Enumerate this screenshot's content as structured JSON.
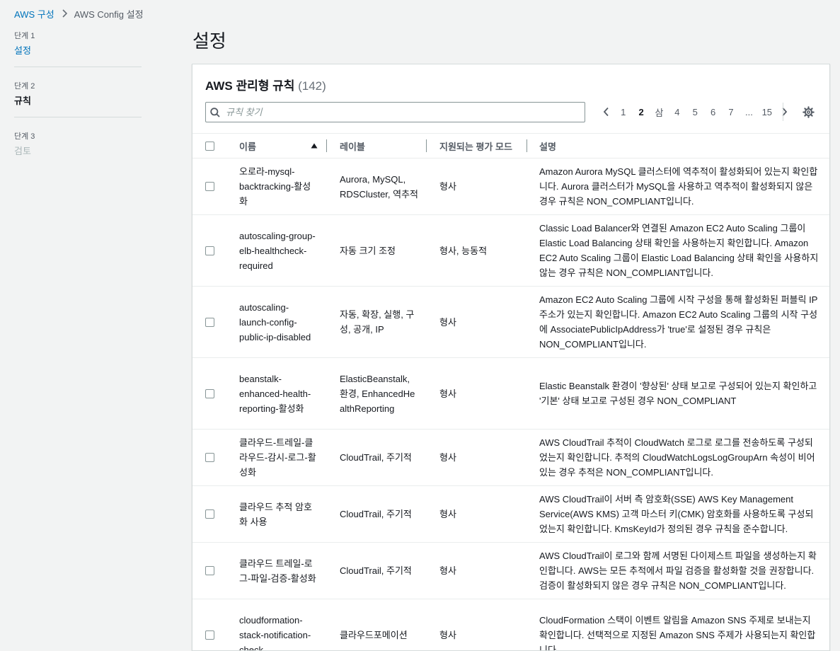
{
  "breadcrumb": {
    "root": "AWS 구성",
    "current": "AWS Config 설정"
  },
  "steps": [
    {
      "num": "단계 1",
      "title": "설정",
      "state": "link"
    },
    {
      "num": "단계 2",
      "title": "규칙",
      "state": "active"
    },
    {
      "num": "단계 3",
      "title": "검토",
      "state": "disabled"
    }
  ],
  "page_title": "설정",
  "panel": {
    "title": "AWS 관리형 규칙",
    "count": "(142)",
    "search_placeholder": "규칙 찾기",
    "pages": [
      "1",
      "2",
      "삼",
      "4",
      "5",
      "6",
      "7",
      "...",
      "15"
    ],
    "current_page": "2"
  },
  "columns": {
    "name": "이름",
    "label": "레이블",
    "mode": "지원되는 평가 모드",
    "desc": "설명"
  },
  "rows": [
    {
      "name": "오로라-mysql-backtracking-활성화",
      "label": "Aurora, MySQL, RDSCluster, 역추적",
      "mode": "형사",
      "desc": "Amazon Aurora MySQL 클러스터에 역추적이 활성화되어 있는지 확인합니다. Aurora 클러스터가 MySQL을 사용하고 역추적이 활성화되지 않은 경우 규칙은 NON_COMPLIANT입니다."
    },
    {
      "name": "autoscaling-group-elb-healthcheck-required",
      "label": "자동 크기 조정",
      "mode": "형사, 능동적",
      "desc": "Classic Load Balancer와 연결된 Amazon EC2 Auto Scaling 그룹이 Elastic Load Balancing 상태 확인을 사용하는지 확인합니다. Amazon EC2 Auto Scaling 그룹이 Elastic Load Balancing 상태 확인을 사용하지 않는 경우 규칙은 NON_COMPLIANT입니다."
    },
    {
      "name": "autoscaling-launch-config-public-ip-disabled",
      "label": "자동, 확장, 실행, 구성, 공개, IP",
      "mode": "형사",
      "desc": "Amazon EC2 Auto Scaling 그룹에 시작 구성을 통해 활성화된 퍼블릭 IP 주소가 있는지 확인합니다. Amazon EC2 Auto Scaling 그룹의 시작 구성에 AssociatePublicIpAddress가 'true'로 설정된 경우 규칙은 NON_COMPLIANT입니다."
    },
    {
      "name": "beanstalk-enhanced-health-reporting-활성화",
      "label": "ElasticBeanstalk, 환경, EnhancedHealthReporting",
      "mode": "형사",
      "desc": "Elastic Beanstalk 환경이 '향상된' 상태 보고로 구성되어 있는지 확인하고 '기본' 상태 보고로 구성된 경우 NON_COMPLIANT"
    },
    {
      "name": "클라우드-트레일-클라우드-감시-로그-활성화",
      "label": "CloudTrail, 주기적",
      "mode": "형사",
      "desc": "AWS CloudTrail 추적이 CloudWatch 로그로 로그를 전송하도록 구성되었는지 확인합니다. 추적의 CloudWatchLogsLogGroupArn 속성이 비어 있는 경우 추적은 NON_COMPLIANT입니다."
    },
    {
      "name": "클라우드 추적 암호화 사용",
      "label": "CloudTrail, 주기적",
      "mode": "형사",
      "desc": "AWS CloudTrail이 서버 측 암호화(SSE) AWS Key Management Service(AWS KMS) 고객 마스터 키(CMK) 암호화를 사용하도록 구성되었는지 확인합니다. KmsKeyId가 정의된 경우 규칙을 준수합니다."
    },
    {
      "name": "클라우드 트레일-로그-파일-검증-활성화",
      "label": "CloudTrail, 주기적",
      "mode": "형사",
      "desc": "AWS CloudTrail이 로그와 함께 서명된 다이제스트 파일을 생성하는지 확인합니다. AWS는 모든 추적에서 파일 검증을 활성화할 것을 권장합니다. 검증이 활성화되지 않은 경우 규칙은 NON_COMPLIANT입니다."
    },
    {
      "name": "cloudformation-stack-notification-check",
      "label": "클라우드포메이션",
      "mode": "형사",
      "desc": "CloudFormation 스택이 이벤트 알림을 Amazon SNS 주제로 보내는지 확인합니다. 선택적으로 지정된 Amazon SNS 주제가 사용되는지 확인합니다."
    }
  ]
}
